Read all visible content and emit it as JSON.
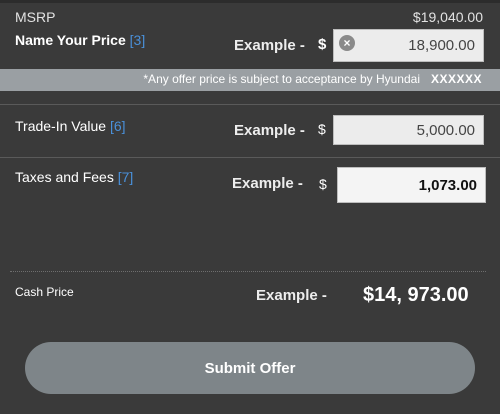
{
  "msrp": {
    "label": "MSRP",
    "value": "$19,040.00"
  },
  "name_your_price": {
    "label": "Name Your Price",
    "ref": "[3]",
    "example": "Example -",
    "currency": "$",
    "value": "18,900.00",
    "clear_icon": "clear-icon"
  },
  "disclaimer": {
    "text": "*Any offer price is subject to acceptance by Hyundai",
    "code": "XXXXXX"
  },
  "trade_in": {
    "label": "Trade-In Value",
    "ref": "[6]",
    "example": "Example -",
    "currency": "$",
    "value": "5,000.00"
  },
  "taxes": {
    "label": "Taxes and Fees",
    "ref": "[7]",
    "example": "Example -",
    "currency": "$",
    "value": "1,073.00"
  },
  "cash_price": {
    "label": "Cash Price",
    "example": "Example -",
    "value": "$14, 973.00"
  },
  "submit": {
    "label": "Submit Offer"
  }
}
